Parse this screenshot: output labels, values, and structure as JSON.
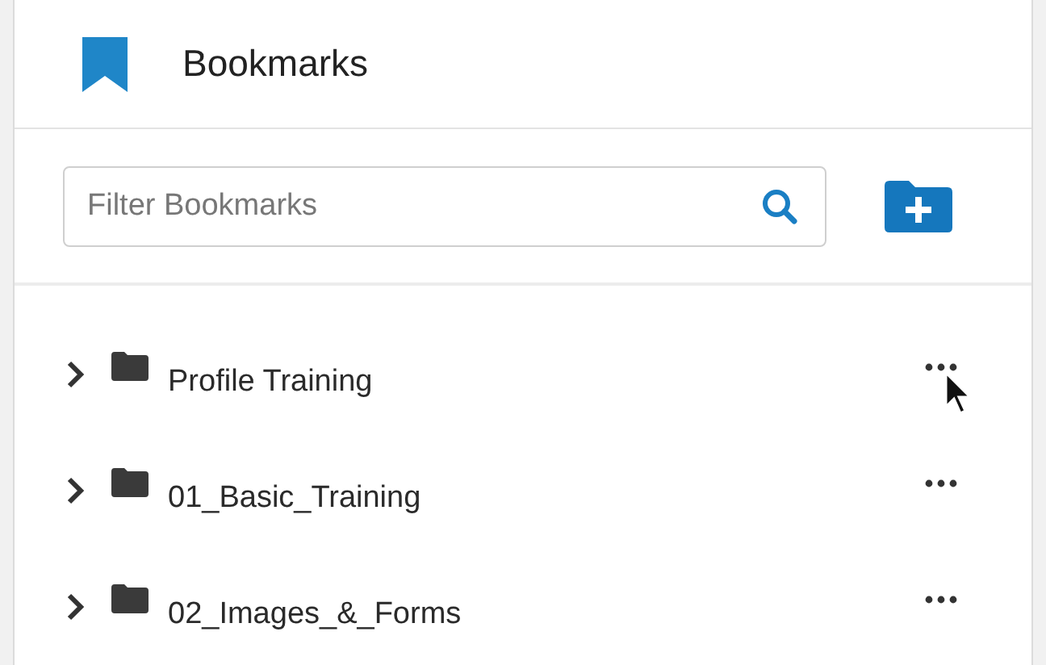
{
  "header": {
    "title": "Bookmarks"
  },
  "filter": {
    "placeholder": "Filter Bookmarks"
  },
  "folders": [
    {
      "label": "Profile Training",
      "expanded": false
    },
    {
      "label": "01_Basic_Training",
      "expanded": false
    },
    {
      "label": "02_Images_&_Forms",
      "expanded": false
    }
  ]
}
